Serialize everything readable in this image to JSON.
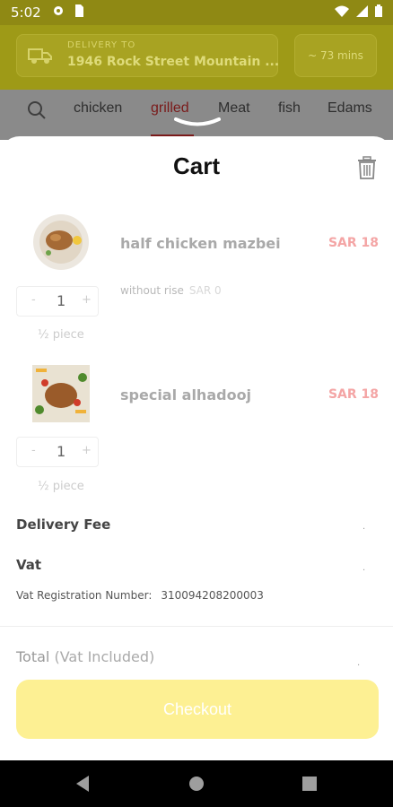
{
  "status_bar": {
    "time": "5:02",
    "icons": [
      "gear-icon",
      "sim-card-icon",
      "wifi-icon",
      "signal-icon",
      "battery-icon"
    ]
  },
  "header": {
    "delivery_label": "DELIVERY TO",
    "address": "1946 Rock Street Mountain ...",
    "eta": "~ 73 mins"
  },
  "categories": {
    "items": [
      "chicken",
      "grilled",
      "Meat",
      "fish",
      "Edams"
    ],
    "active": "grilled"
  },
  "cart": {
    "title": "Cart",
    "items": [
      {
        "name": "half chicken mazbei",
        "price": "SAR 18",
        "modifier": "without rise",
        "modifier_price": "SAR 0",
        "minus": "-",
        "quantity": "1",
        "plus": "+",
        "unit": "½ piece"
      },
      {
        "name": "special alhadooj",
        "price": "SAR 18",
        "minus": "-",
        "quantity": "1",
        "plus": "+",
        "unit": "½ piece"
      }
    ],
    "delivery_fee_label": "Delivery Fee",
    "delivery_fee_value": ".",
    "vat_label": "Vat",
    "vat_value": ".",
    "vat_registration_label": "Vat Registration Number:",
    "vat_registration_number": "310094208200003",
    "total_label": "Total",
    "total_sub": "(Vat Included)",
    "total_value": ".",
    "checkout_label": "Checkout"
  },
  "colors": {
    "brand_yellow": "#fdf093",
    "price_red": "#f4a5a5",
    "active_tab": "#7a1a1a"
  }
}
